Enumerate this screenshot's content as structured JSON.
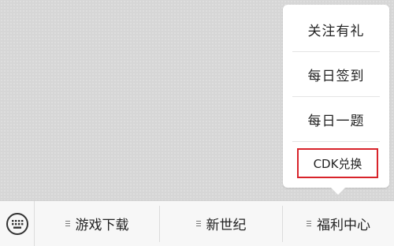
{
  "popup_menu": {
    "items": [
      {
        "label": "关注有礼"
      },
      {
        "label": "每日签到"
      },
      {
        "label": "每日一题"
      },
      {
        "label": "CDK兑换"
      }
    ],
    "highlight_color": "#d8232a"
  },
  "bottom_bar": {
    "keyboard_icon": "keyboard-icon",
    "tabs": [
      {
        "label": "游戏下载",
        "icon": "menu-lines-icon"
      },
      {
        "label": "新世纪",
        "icon": "menu-lines-icon"
      },
      {
        "label": "福利中心",
        "icon": "menu-lines-icon"
      }
    ]
  }
}
